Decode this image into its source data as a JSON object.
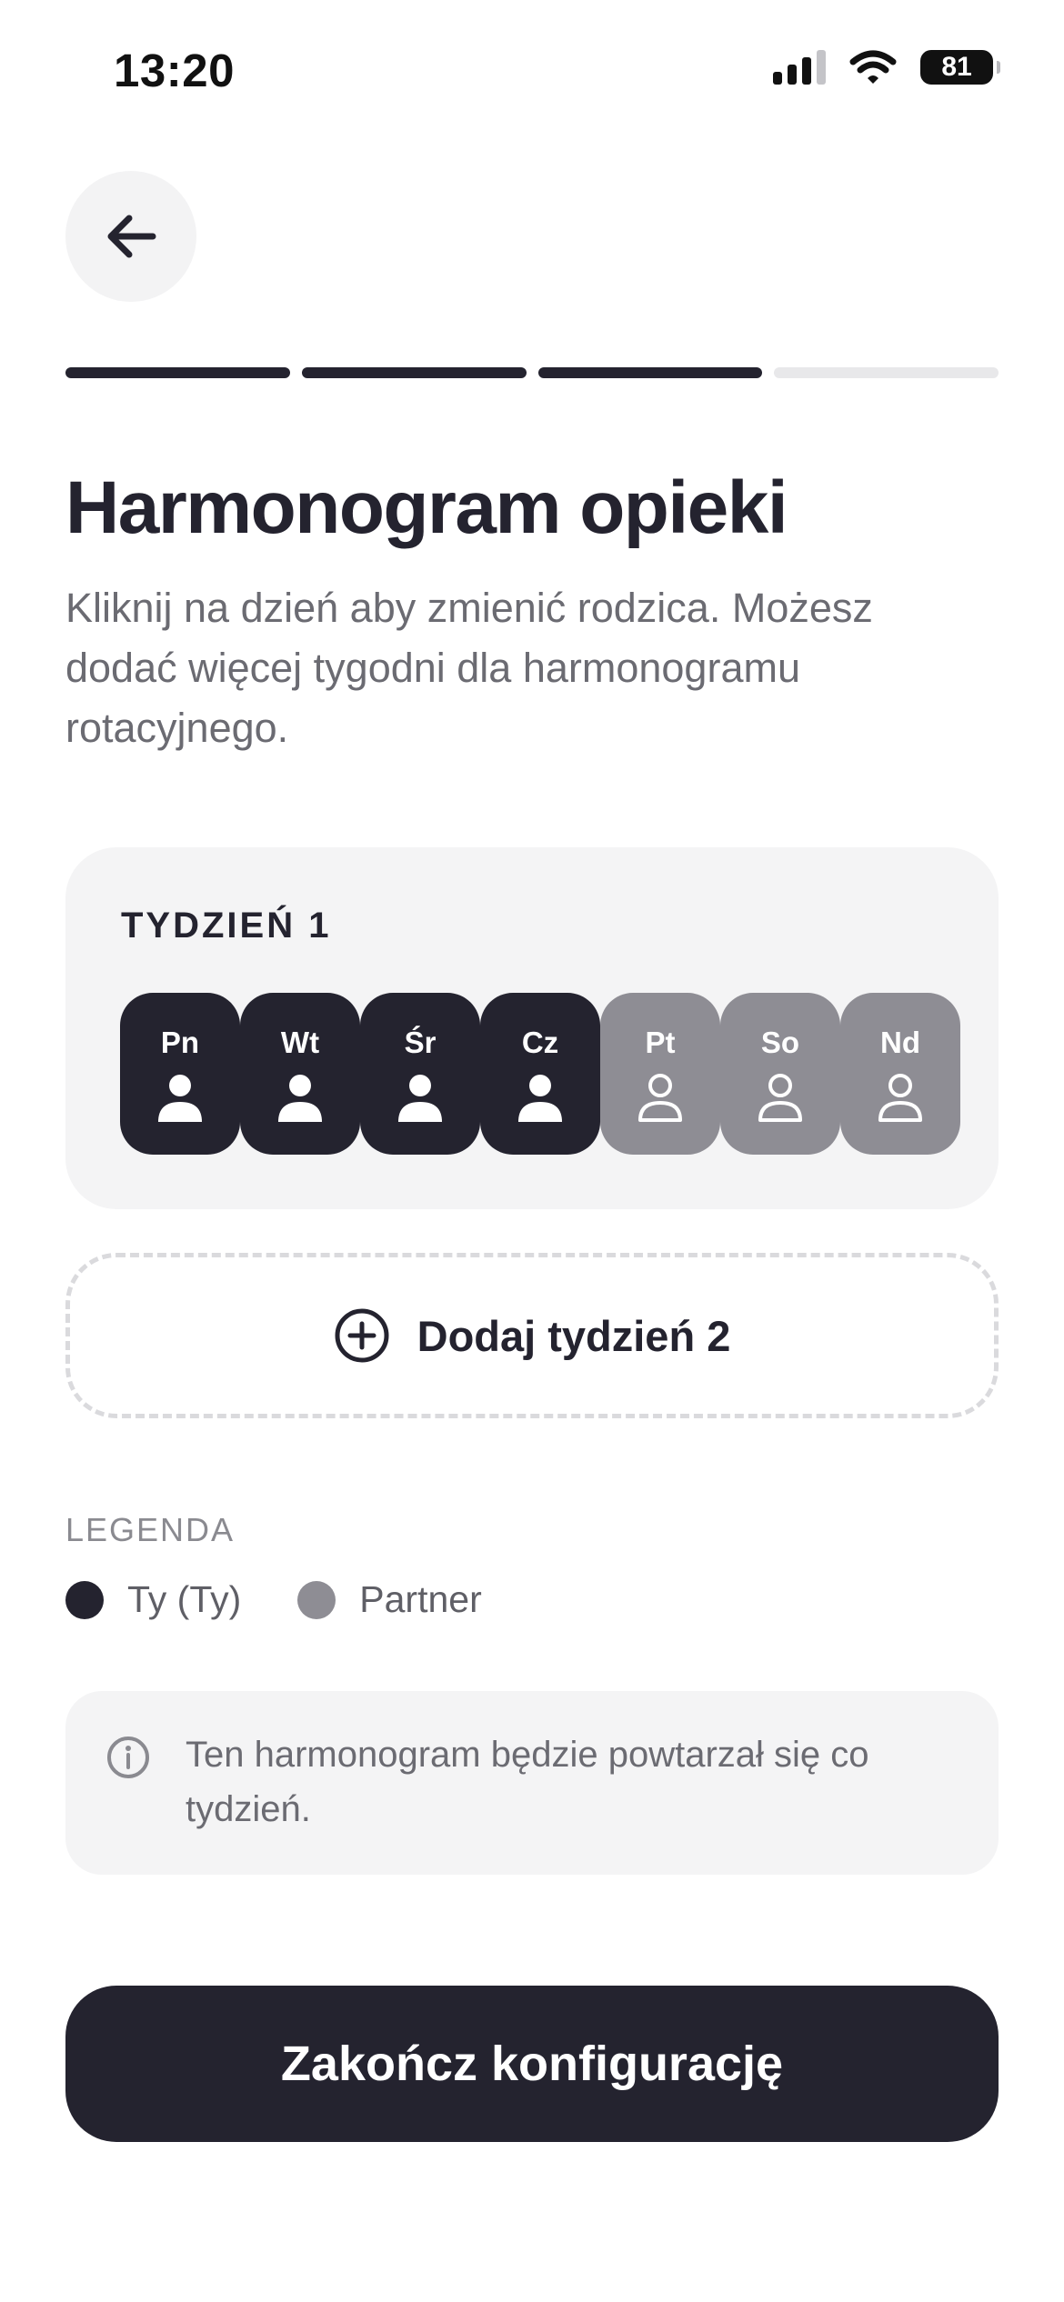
{
  "status_bar": {
    "time": "13:20",
    "battery": "81",
    "icons": [
      "signal-icon",
      "wifi-icon",
      "battery-icon"
    ]
  },
  "header": {
    "back_icon": "arrow-left-icon",
    "progress_steps": 4,
    "progress_completed": 3
  },
  "page": {
    "title": "Harmonogram opieki",
    "subtitle": "Kliknij na dzień aby zmienić rodzica. Możesz dodać więcej tygodni dla harmonogramu rotacyjnego."
  },
  "week": {
    "title": "TYDZIEŃ 1",
    "days": [
      {
        "label": "Pn",
        "assignee": "me"
      },
      {
        "label": "Wt",
        "assignee": "me"
      },
      {
        "label": "Śr",
        "assignee": "me"
      },
      {
        "label": "Cz",
        "assignee": "me"
      },
      {
        "label": "Pt",
        "assignee": "partner"
      },
      {
        "label": "So",
        "assignee": "partner"
      },
      {
        "label": "Nd",
        "assignee": "partner"
      }
    ]
  },
  "add_week": {
    "label": "Dodaj tydzień 2",
    "icon": "plus-circle-icon"
  },
  "legend": {
    "title": "LEGENDA",
    "items": [
      {
        "label": "Ty (Ty)",
        "color": "#24232f"
      },
      {
        "label": "Partner",
        "color": "#8e8d94"
      }
    ]
  },
  "info": {
    "icon": "info-icon",
    "text": "Ten harmonogram będzie powtarzał się co tydzień."
  },
  "finish": {
    "label": "Zakończ konfigurację"
  },
  "colors": {
    "primary": "#24232f",
    "partner": "#8e8d94",
    "card_bg": "#f4f4f5",
    "muted_text": "#6b6b72"
  }
}
